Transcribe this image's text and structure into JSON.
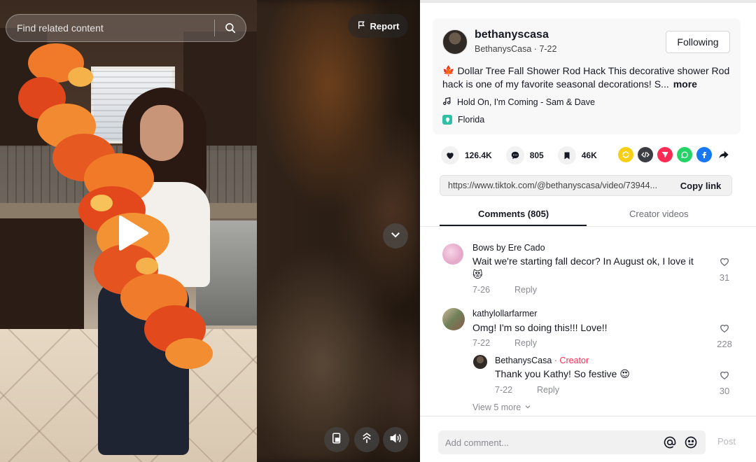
{
  "video": {
    "search_placeholder": "Find related content",
    "report_label": "Report"
  },
  "post": {
    "author_name": "bethanyscasa",
    "author_display": "BethanysCasa",
    "date": "7-22",
    "follow_label": "Following",
    "description": "Dollar Tree Fall Shower Rod Hack This decorative shower Rod hack is one of my favorite seasonal decorations! S...",
    "more_label": "more",
    "music": "Hold On, I'm Coming - Sam & Dave",
    "location": "Florida"
  },
  "stats": {
    "likes": "126.4K",
    "comments": "805",
    "saves": "46K"
  },
  "share": {
    "url": "https://www.tiktok.com/@bethanyscasa/video/73944...",
    "copy_label": "Copy link"
  },
  "tabs": {
    "comments": "Comments (805)",
    "creator_videos": "Creator videos"
  },
  "comments": [
    {
      "user": "Bows by Ere Cado",
      "text": "Wait we're starting fall decor? In August ok, I love it",
      "emoji": "😻",
      "date": "7-26",
      "reply_label": "Reply",
      "likes": "31"
    },
    {
      "user": "kathylollarfarmer",
      "text": "Omg! I'm so doing this!!! Love!!",
      "date": "7-22",
      "reply_label": "Reply",
      "likes": "228",
      "reply": {
        "user": "BethanysCasa",
        "badge": "· Creator",
        "text": "Thank you Kathy! So festive 😍",
        "date": "7-22",
        "reply_label": "Reply",
        "likes": "30"
      },
      "view_more": "View 5 more"
    }
  ],
  "composer": {
    "placeholder": "Add comment...",
    "post_label": "Post"
  },
  "colors": {
    "accent": "#fe2c55",
    "whatsapp": "#25d366",
    "facebook": "#1877f2"
  }
}
